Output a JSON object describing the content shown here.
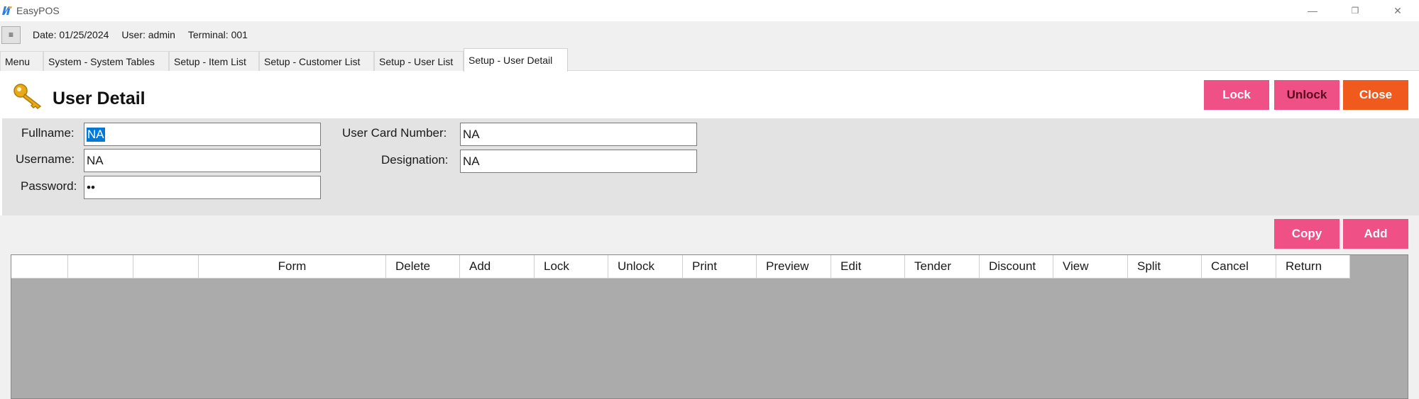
{
  "window": {
    "title": "EasyPOS",
    "minimize": "—",
    "restore": "❐",
    "close": "✕"
  },
  "status": {
    "menu_button": "≡",
    "date": "Date: 01/25/2024",
    "user": "User: admin",
    "terminal": "Terminal: 001"
  },
  "tabs": [
    {
      "label": "Menu"
    },
    {
      "label": "System - System Tables"
    },
    {
      "label": "Setup - Item List"
    },
    {
      "label": "Setup - Customer List"
    },
    {
      "label": "Setup - User List"
    },
    {
      "label": "Setup - User Detail",
      "active": true
    }
  ],
  "page": {
    "title": "User Detail",
    "icon": "key-icon"
  },
  "actions": {
    "lock": "Lock",
    "unlock": "Unlock",
    "close": "Close",
    "copy": "Copy",
    "add": "Add"
  },
  "form": {
    "fullname_label": "Fullname:",
    "fullname_value": "NA",
    "username_label": "Username:",
    "username_value": "NA",
    "password_label": "Password:",
    "password_value": "••",
    "card_label": "User Card Number:",
    "card_value": "NA",
    "designation_label": "Designation:",
    "designation_value": "NA"
  },
  "grid": {
    "columns": [
      "",
      "",
      "",
      "Form",
      "Delete",
      "Add",
      "Lock",
      "Unlock",
      "Print",
      "Preview",
      "Edit",
      "Tender",
      "Discount",
      "View",
      "Split",
      "Cancel",
      "Return"
    ]
  },
  "colors": {
    "pink": "#ef5186",
    "orange": "#f05a1c",
    "grid_bg": "#ababab",
    "selection": "#0078d7"
  }
}
